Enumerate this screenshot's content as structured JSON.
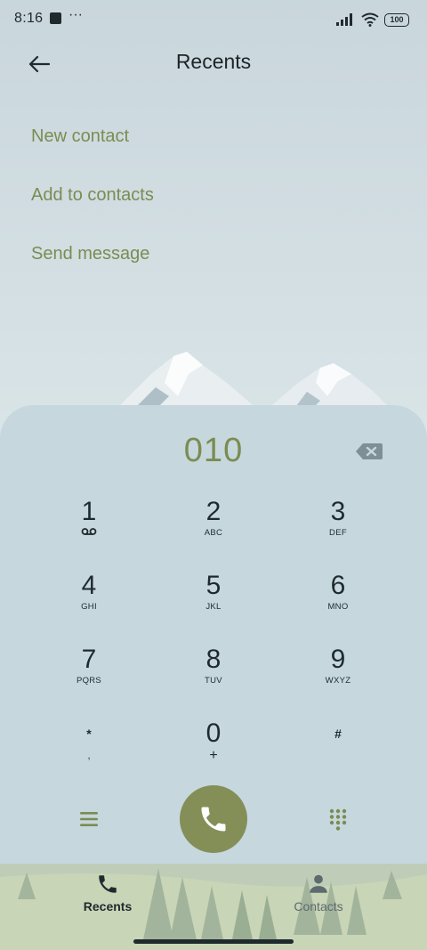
{
  "status_bar": {
    "time": "8:16",
    "dots": "···",
    "battery": "100"
  },
  "header": {
    "title": "Recents"
  },
  "menu": {
    "items": [
      "New contact",
      "Add to contacts",
      "Send message"
    ]
  },
  "dialer": {
    "display": "010",
    "keys": [
      {
        "digit": "1",
        "letters": "",
        "sub_icon": "voicemail-icon"
      },
      {
        "digit": "2",
        "letters": "ABC"
      },
      {
        "digit": "3",
        "letters": "DEF"
      },
      {
        "digit": "4",
        "letters": "GHI"
      },
      {
        "digit": "5",
        "letters": "JKL"
      },
      {
        "digit": "6",
        "letters": "MNO"
      },
      {
        "digit": "7",
        "letters": "PQRS"
      },
      {
        "digit": "8",
        "letters": "TUV"
      },
      {
        "digit": "9",
        "letters": "WXYZ"
      },
      {
        "digit": "*",
        "letters": ","
      },
      {
        "digit": "0",
        "letters": "+"
      },
      {
        "digit": "#",
        "letters": ""
      }
    ]
  },
  "bottom_nav": {
    "tabs": [
      {
        "label": "Recents",
        "icon": "phone-icon",
        "active": true
      },
      {
        "label": "Contacts",
        "icon": "person-icon",
        "active": false
      }
    ]
  },
  "colors": {
    "accent": "#7b8c52",
    "call_button": "#848f57",
    "dialer_bg": "#c6d7de",
    "text_dark": "#1f2a2e"
  }
}
